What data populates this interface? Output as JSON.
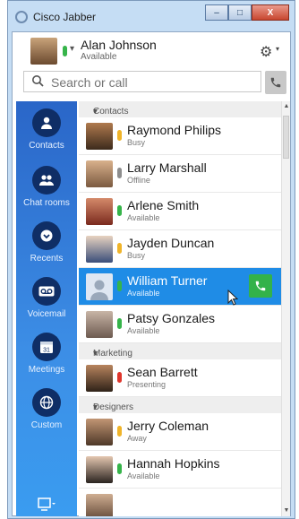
{
  "window": {
    "title": "Cisco Jabber",
    "min": "–",
    "max": "□",
    "close": "X"
  },
  "me": {
    "name": "Alan Johnson",
    "status": "Available",
    "status_color": "#36b44a"
  },
  "search": {
    "placeholder": "Search or call"
  },
  "nav": [
    {
      "label": "Contacts",
      "icon": "person-icon"
    },
    {
      "label": "Chat rooms",
      "icon": "chat-rooms-icon"
    },
    {
      "label": "Recents",
      "icon": "clock-icon"
    },
    {
      "label": "Voicemail",
      "icon": "voicemail-icon"
    },
    {
      "label": "Meetings",
      "icon": "calendar-icon",
      "calendar_day": "31"
    },
    {
      "label": "Custom",
      "icon": "globe-icon"
    }
  ],
  "groups": [
    {
      "name": "Contacts",
      "contacts": [
        {
          "name": "Raymond Philips",
          "status": "Busy",
          "color": "#f0b429"
        },
        {
          "name": "Larry Marshall",
          "status": "Offline",
          "color": "#8d8d8d"
        },
        {
          "name": "Arlene Smith",
          "status": "Available",
          "color": "#36b44a"
        },
        {
          "name": "Jayden Duncan",
          "status": "Busy",
          "color": "#f0b429"
        },
        {
          "name": "William Turner",
          "status": "Available",
          "color": "#36b44a",
          "selected": true
        },
        {
          "name": "Patsy Gonzales",
          "status": "Available",
          "color": "#36b44a"
        }
      ]
    },
    {
      "name": "Marketing",
      "contacts": [
        {
          "name": "Sean Barrett",
          "status": "Presenting",
          "color": "#e0362c"
        }
      ]
    },
    {
      "name": "Designers",
      "contacts": [
        {
          "name": "Jerry Coleman",
          "status": "Away",
          "color": "#f0b429"
        },
        {
          "name": "Hannah Hopkins",
          "status": "Available",
          "color": "#36b44a"
        }
      ]
    }
  ]
}
